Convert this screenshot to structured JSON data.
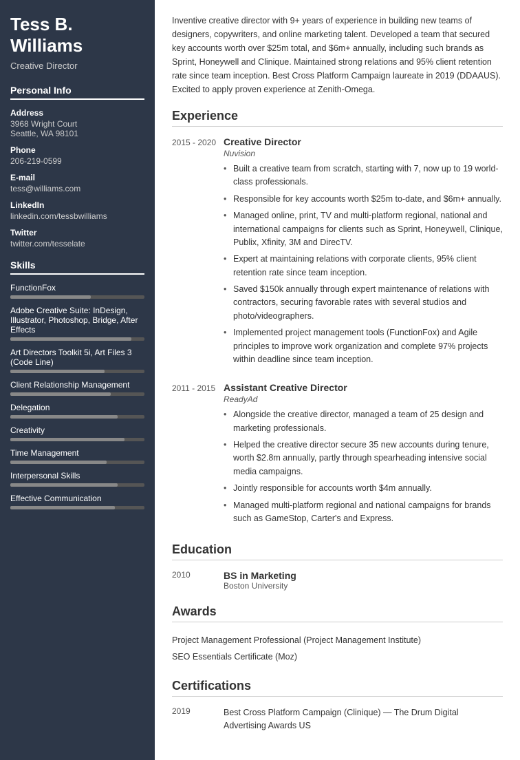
{
  "sidebar": {
    "name": "Tess B. Williams",
    "title": "Creative Director",
    "personal_info_label": "Personal Info",
    "address_label": "Address",
    "address_value": "3968 Wright Court",
    "address_city": "Seattle, WA 98101",
    "phone_label": "Phone",
    "phone_value": "206-219-0599",
    "email_label": "E-mail",
    "email_value": "tess@williams.com",
    "linkedin_label": "LinkedIn",
    "linkedin_value": "linkedin.com/tessbwilliams",
    "twitter_label": "Twitter",
    "twitter_value": "twitter.com/tesselate",
    "skills_label": "Skills",
    "skills": [
      {
        "name": "FunctionFox",
        "pct": 60
      },
      {
        "name": "Adobe Creative Suite: InDesign, Illustrator, Photoshop, Bridge, After Effects",
        "pct": 90
      },
      {
        "name": "Art Directors Toolkit 5i, Art Files 3 (Code Line)",
        "pct": 70
      },
      {
        "name": "Client Relationship Management",
        "pct": 75
      },
      {
        "name": "Delegation",
        "pct": 80
      },
      {
        "name": "Creativity",
        "pct": 85
      },
      {
        "name": "Time Management",
        "pct": 72
      },
      {
        "name": "Interpersonal Skills",
        "pct": 80
      },
      {
        "name": "Effective Communication",
        "pct": 78
      }
    ]
  },
  "summary": "Inventive creative director with 9+ years of experience in building new teams of designers, copywriters, and online marketing talent. Developed a team that secured key accounts worth over $25m total, and $6m+ annually, including such brands as Sprint, Honeywell and Clinique. Maintained strong relations and 95% client retention rate since team inception. Best Cross Platform Campaign laureate in 2019 (DDAAUS). Excited to apply proven experience at Zenith-Omega.",
  "sections": {
    "experience_label": "Experience",
    "education_label": "Education",
    "awards_label": "Awards",
    "certifications_label": "Certifications"
  },
  "experience": [
    {
      "dates": "2015 - 2020",
      "title": "Creative Director",
      "company": "Nuvision",
      "bullets": [
        "Built a creative team from scratch, starting with 7, now up to 19 world-class professionals.",
        "Responsible for key accounts worth $25m to-date, and $6m+ annually.",
        "Managed online, print, TV and multi-platform regional, national and international campaigns for clients such as Sprint, Honeywell, Clinique, Publix, Xfinity, 3M and DirecTV.",
        "Expert at maintaining relations with corporate clients, 95% client retention rate since team inception.",
        "Saved $150k annually through expert maintenance of relations with contractors, securing favorable rates with several studios and photo/videographers.",
        "Implemented project management tools (FunctionFox) and Agile principles to improve work organization and complete 97% projects within deadline since team inception."
      ]
    },
    {
      "dates": "2011 - 2015",
      "title": "Assistant Creative Director",
      "company": "ReadyAd",
      "bullets": [
        "Alongside the creative director, managed a team of 25 design and marketing professionals.",
        "Helped the creative director secure 35 new accounts during tenure, worth $2.8m annually, partly through spearheading intensive social media campaigns.",
        "Jointly responsible for accounts worth $4m annually.",
        "Managed multi-platform regional and national campaigns for brands such as GameStop, Carter's and Express."
      ]
    }
  ],
  "education": [
    {
      "date": "2010",
      "degree": "BS in Marketing",
      "school": "Boston University"
    }
  ],
  "awards": [
    "Project Management Professional (Project Management Institute)",
    "SEO Essentials Certificate (Moz)"
  ],
  "certifications": [
    {
      "date": "2019",
      "text": "Best Cross Platform Campaign (Clinique) — The Drum Digital Advertising Awards US"
    }
  ]
}
